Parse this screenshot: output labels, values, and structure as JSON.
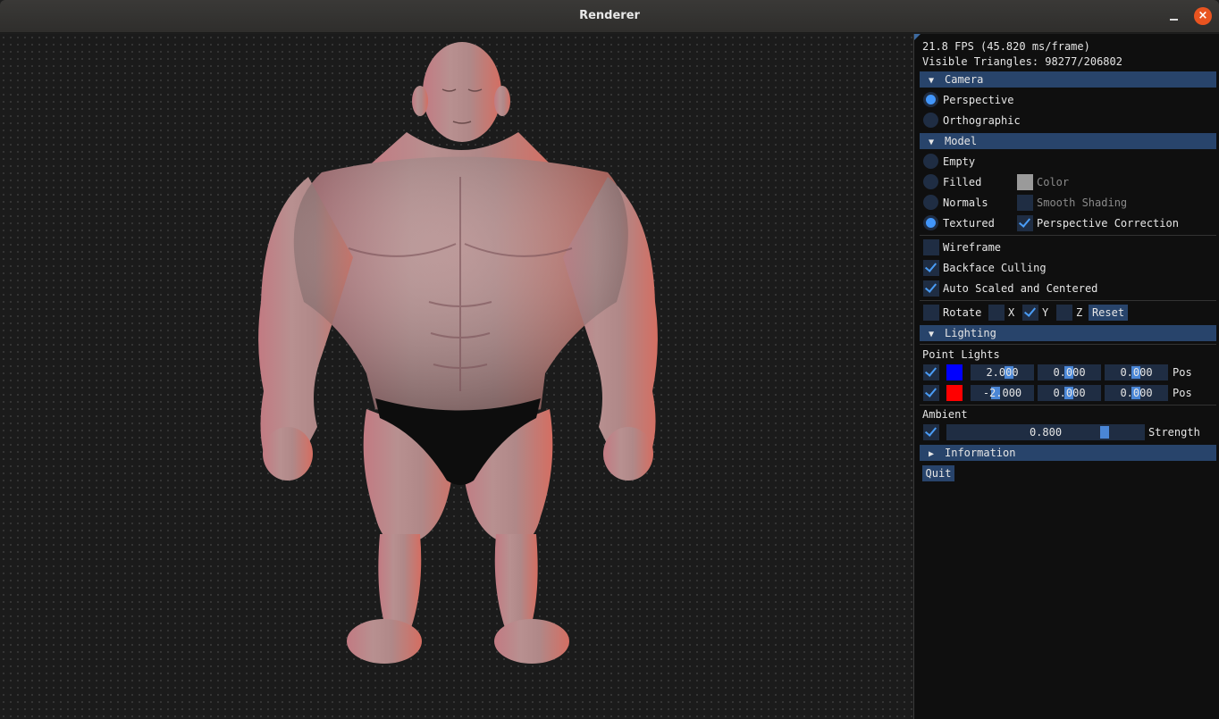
{
  "window": {
    "title": "Renderer"
  },
  "stats": {
    "fps_line": "21.8 FPS (45.820 ms/frame)",
    "triangles_line": "Visible Triangles: 98277/206802"
  },
  "camera": {
    "header": "Camera",
    "perspective": "Perspective",
    "orthographic": "Orthographic",
    "selected": "Perspective"
  },
  "model": {
    "header": "Model",
    "empty": "Empty",
    "filled": "Filled",
    "normals": "Normals",
    "textured": "Textured",
    "selected": "Textured",
    "color": "Color",
    "color_value": "#9a9a9a",
    "smooth_shading": "Smooth Shading",
    "smooth_shading_checked": false,
    "perspective_correction": "Perspective Correction",
    "perspective_correction_checked": true,
    "wireframe": "Wireframe",
    "wireframe_checked": false,
    "backface_culling": "Backface Culling",
    "backface_culling_checked": true,
    "auto_scaled": "Auto Scaled and Centered",
    "auto_scaled_checked": true,
    "rotate": "Rotate",
    "rotate_checked": false,
    "x": "X",
    "x_checked": false,
    "y": "Y",
    "y_checked": true,
    "z": "Z",
    "z_checked": false,
    "reset": "Reset"
  },
  "lighting": {
    "header": "Lighting",
    "point_lights_label": "Point Lights",
    "lights": [
      {
        "enabled": true,
        "color": "#0000ff",
        "x": "2.000",
        "y": "0.000",
        "z": "0.000",
        "pos_label": "Pos"
      },
      {
        "enabled": true,
        "color": "#ff0000",
        "x": "-2.000",
        "y": "0.000",
        "z": "0.000",
        "pos_label": "Pos"
      }
    ],
    "ambient_label": "Ambient",
    "ambient_enabled": true,
    "ambient_strength": "0.800",
    "strength_label": "Strength"
  },
  "information": {
    "header": "Information"
  },
  "quit": "Quit",
  "icons": {
    "expanded": "triangle-down-icon",
    "collapsed": "triangle-right-icon"
  }
}
